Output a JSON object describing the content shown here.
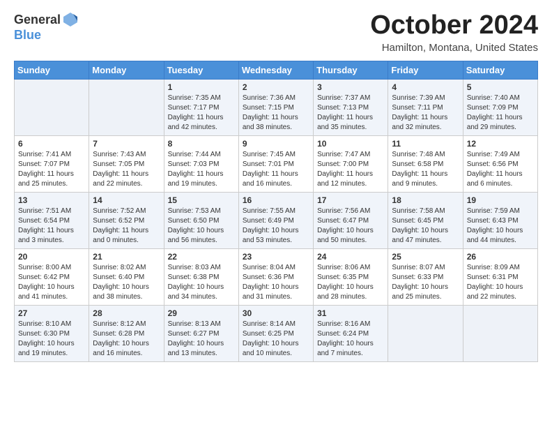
{
  "header": {
    "logo_general": "General",
    "logo_blue": "Blue",
    "month_title": "October 2024",
    "location": "Hamilton, Montana, United States"
  },
  "days_of_week": [
    "Sunday",
    "Monday",
    "Tuesday",
    "Wednesday",
    "Thursday",
    "Friday",
    "Saturday"
  ],
  "weeks": [
    [
      {
        "num": "",
        "info": ""
      },
      {
        "num": "",
        "info": ""
      },
      {
        "num": "1",
        "info": "Sunrise: 7:35 AM\nSunset: 7:17 PM\nDaylight: 11 hours and 42 minutes."
      },
      {
        "num": "2",
        "info": "Sunrise: 7:36 AM\nSunset: 7:15 PM\nDaylight: 11 hours and 38 minutes."
      },
      {
        "num": "3",
        "info": "Sunrise: 7:37 AM\nSunset: 7:13 PM\nDaylight: 11 hours and 35 minutes."
      },
      {
        "num": "4",
        "info": "Sunrise: 7:39 AM\nSunset: 7:11 PM\nDaylight: 11 hours and 32 minutes."
      },
      {
        "num": "5",
        "info": "Sunrise: 7:40 AM\nSunset: 7:09 PM\nDaylight: 11 hours and 29 minutes."
      }
    ],
    [
      {
        "num": "6",
        "info": "Sunrise: 7:41 AM\nSunset: 7:07 PM\nDaylight: 11 hours and 25 minutes."
      },
      {
        "num": "7",
        "info": "Sunrise: 7:43 AM\nSunset: 7:05 PM\nDaylight: 11 hours and 22 minutes."
      },
      {
        "num": "8",
        "info": "Sunrise: 7:44 AM\nSunset: 7:03 PM\nDaylight: 11 hours and 19 minutes."
      },
      {
        "num": "9",
        "info": "Sunrise: 7:45 AM\nSunset: 7:01 PM\nDaylight: 11 hours and 16 minutes."
      },
      {
        "num": "10",
        "info": "Sunrise: 7:47 AM\nSunset: 7:00 PM\nDaylight: 11 hours and 12 minutes."
      },
      {
        "num": "11",
        "info": "Sunrise: 7:48 AM\nSunset: 6:58 PM\nDaylight: 11 hours and 9 minutes."
      },
      {
        "num": "12",
        "info": "Sunrise: 7:49 AM\nSunset: 6:56 PM\nDaylight: 11 hours and 6 minutes."
      }
    ],
    [
      {
        "num": "13",
        "info": "Sunrise: 7:51 AM\nSunset: 6:54 PM\nDaylight: 11 hours and 3 minutes."
      },
      {
        "num": "14",
        "info": "Sunrise: 7:52 AM\nSunset: 6:52 PM\nDaylight: 11 hours and 0 minutes."
      },
      {
        "num": "15",
        "info": "Sunrise: 7:53 AM\nSunset: 6:50 PM\nDaylight: 10 hours and 56 minutes."
      },
      {
        "num": "16",
        "info": "Sunrise: 7:55 AM\nSunset: 6:49 PM\nDaylight: 10 hours and 53 minutes."
      },
      {
        "num": "17",
        "info": "Sunrise: 7:56 AM\nSunset: 6:47 PM\nDaylight: 10 hours and 50 minutes."
      },
      {
        "num": "18",
        "info": "Sunrise: 7:58 AM\nSunset: 6:45 PM\nDaylight: 10 hours and 47 minutes."
      },
      {
        "num": "19",
        "info": "Sunrise: 7:59 AM\nSunset: 6:43 PM\nDaylight: 10 hours and 44 minutes."
      }
    ],
    [
      {
        "num": "20",
        "info": "Sunrise: 8:00 AM\nSunset: 6:42 PM\nDaylight: 10 hours and 41 minutes."
      },
      {
        "num": "21",
        "info": "Sunrise: 8:02 AM\nSunset: 6:40 PM\nDaylight: 10 hours and 38 minutes."
      },
      {
        "num": "22",
        "info": "Sunrise: 8:03 AM\nSunset: 6:38 PM\nDaylight: 10 hours and 34 minutes."
      },
      {
        "num": "23",
        "info": "Sunrise: 8:04 AM\nSunset: 6:36 PM\nDaylight: 10 hours and 31 minutes."
      },
      {
        "num": "24",
        "info": "Sunrise: 8:06 AM\nSunset: 6:35 PM\nDaylight: 10 hours and 28 minutes."
      },
      {
        "num": "25",
        "info": "Sunrise: 8:07 AM\nSunset: 6:33 PM\nDaylight: 10 hours and 25 minutes."
      },
      {
        "num": "26",
        "info": "Sunrise: 8:09 AM\nSunset: 6:31 PM\nDaylight: 10 hours and 22 minutes."
      }
    ],
    [
      {
        "num": "27",
        "info": "Sunrise: 8:10 AM\nSunset: 6:30 PM\nDaylight: 10 hours and 19 minutes."
      },
      {
        "num": "28",
        "info": "Sunrise: 8:12 AM\nSunset: 6:28 PM\nDaylight: 10 hours and 16 minutes."
      },
      {
        "num": "29",
        "info": "Sunrise: 8:13 AM\nSunset: 6:27 PM\nDaylight: 10 hours and 13 minutes."
      },
      {
        "num": "30",
        "info": "Sunrise: 8:14 AM\nSunset: 6:25 PM\nDaylight: 10 hours and 10 minutes."
      },
      {
        "num": "31",
        "info": "Sunrise: 8:16 AM\nSunset: 6:24 PM\nDaylight: 10 hours and 7 minutes."
      },
      {
        "num": "",
        "info": ""
      },
      {
        "num": "",
        "info": ""
      }
    ]
  ]
}
